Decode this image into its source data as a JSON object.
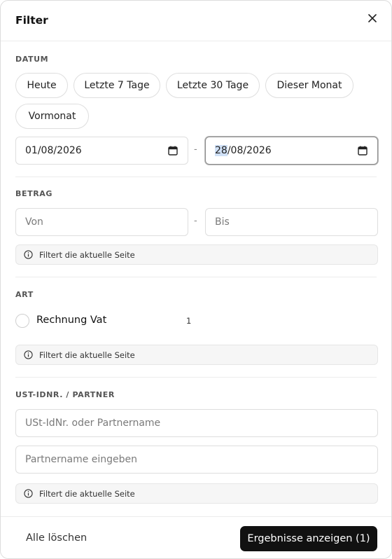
{
  "header": {
    "title": "Filter",
    "close_icon": "close-icon"
  },
  "datum": {
    "label": "DATUM",
    "chips": [
      "Heute",
      "Letzte 7 Tage",
      "Letzte 30 Tage",
      "Dieser Monat",
      "Vormonat"
    ],
    "from": {
      "value": "01/08/2026"
    },
    "separator": "-",
    "to": {
      "day": "28",
      "rest": "/08/2026"
    }
  },
  "betrag": {
    "label": "BETRAG",
    "from_placeholder": "Von",
    "separator": "-",
    "to_placeholder": "Bis",
    "note": "Filtert die aktuelle Seite"
  },
  "art": {
    "label": "ART",
    "option_label": "Rechnung Vat",
    "option_count": "1",
    "note": "Filtert die aktuelle Seite"
  },
  "partner": {
    "label": "UST-IDNR. / PARTNER",
    "ust_placeholder": "USt-IdNr. oder Partnername",
    "name_placeholder": "Partnername eingeben",
    "note": "Filtert die aktuelle Seite"
  },
  "footer": {
    "clear_label": "Alle löschen",
    "apply_label": "Ergebnisse anzeigen (1)"
  }
}
